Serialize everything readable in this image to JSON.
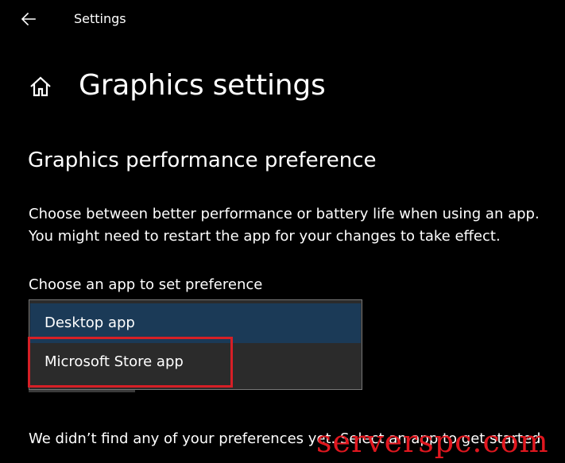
{
  "window": {
    "app_title": "Settings"
  },
  "page": {
    "title": "Graphics settings"
  },
  "section": {
    "title": "Graphics performance preference",
    "description_line1": "Choose between better performance or battery life when using an app.",
    "description_line2": "You might need to restart the app for your changes to take effect."
  },
  "app_picker": {
    "label": "Choose an app to set preference",
    "options": [
      {
        "label": "Desktop app",
        "state": "hover"
      },
      {
        "label": "Microsoft Store app",
        "state": "highlighted"
      }
    ]
  },
  "footer": {
    "text": "We didn’t find any of your preferences yet. Select an app to get started."
  },
  "watermark": {
    "text": "serverspc.com"
  },
  "colors": {
    "background": "#000000",
    "text": "#ffffff",
    "dropdown_bg": "#2b2b2b",
    "option_hover": "#1b3a57",
    "annotation_red": "#d61f26",
    "watermark_red": "#e0171f"
  },
  "icons": {
    "back": "back-arrow-icon",
    "home": "home-icon"
  }
}
